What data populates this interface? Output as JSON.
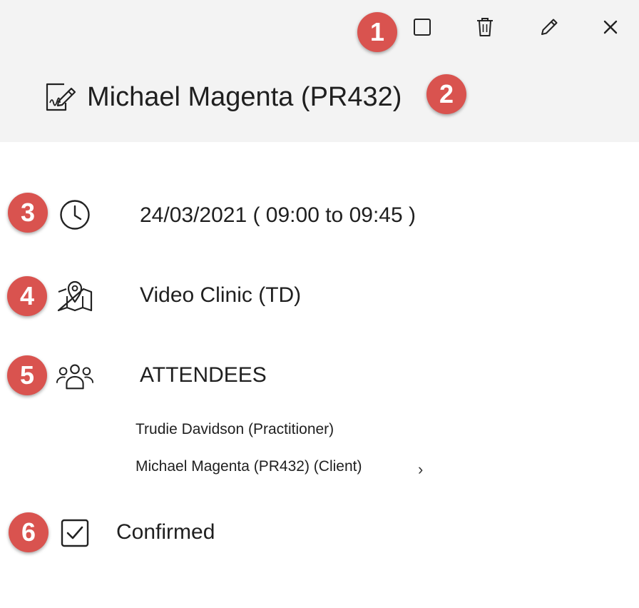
{
  "colors": {
    "badge": "#d9534f",
    "header_bg": "#f3f3f3",
    "text": "#1f1f1f"
  },
  "badges": [
    "1",
    "2",
    "3",
    "4",
    "5",
    "6"
  ],
  "toolbar": {
    "icons": [
      "checkbox-icon",
      "trash-icon",
      "pencil-icon",
      "close-icon"
    ]
  },
  "appointment": {
    "title_icon": "signed-document-icon",
    "title": "Michael Magenta (PR432)",
    "datetime": "24/03/2021 ( 09:00 to 09:45 )",
    "location": "Video Clinic (TD)",
    "attendees_label": "ATTENDEES",
    "attendees": [
      "Trudie Davidson (Practitioner)",
      "Michael Magenta (PR432) (Client)"
    ],
    "attendee_chevron": "›",
    "status": "Confirmed"
  }
}
